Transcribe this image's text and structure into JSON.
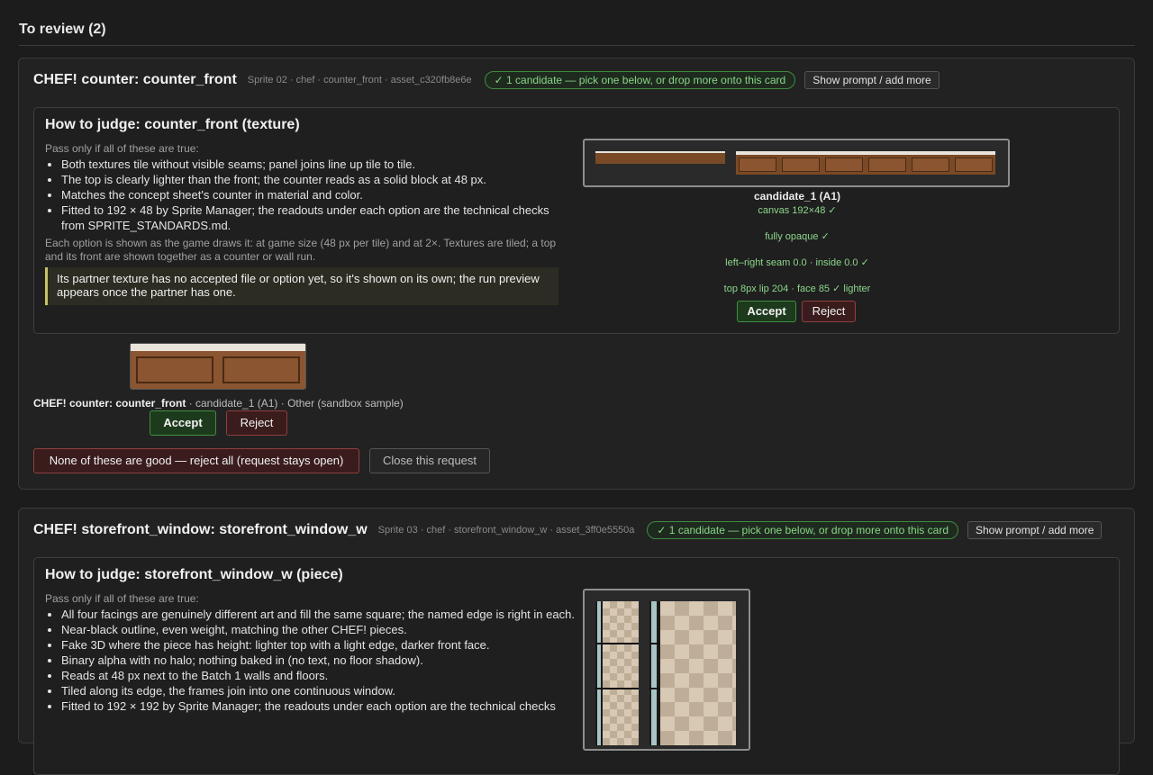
{
  "section": {
    "title": "To review (2)"
  },
  "cards": [
    {
      "title": "CHEF! counter: counter_front",
      "meta": "Sprite 02 · chef · counter_front · asset_c320fb8e6e",
      "candidate_pill": "✓ 1 candidate — pick one below, or drop more onto this card",
      "show_prompt": "Show prompt / add more",
      "judge": {
        "title": "How to judge: counter_front (texture)",
        "intro": "Pass only if all of these are true:",
        "criteria": [
          "Both textures tile without visible seams; panel joins line up tile to tile.",
          "The top is clearly lighter than the front; the counter reads as a solid block at 48 px.",
          "Matches the concept sheet's counter in material and color.",
          "Fitted to 192 × 48 by Sprite Manager; the readouts under each option are the technical checks from SPRITE_STANDARDS.md."
        ],
        "note": "Each option is shown as the game draws it: at game size (48 px per tile) and at 2×. Textures are tiled; a top and its front are shown together as a counter or wall run.",
        "warning": "Its partner texture has no accepted file or option yet, so it's shown on its own; the run preview appears once the partner has one."
      },
      "candidate": {
        "title": "candidate_1 (A1)",
        "checks": [
          "canvas 192×48 ✓",
          "fully opaque ✓",
          "left–right seam 0.0 · inside 0.0 ✓",
          "top 8px lip 204 · face 85 ✓ lighter"
        ],
        "accept": "Accept",
        "reject": "Reject"
      },
      "sample": {
        "name": "CHEF! counter: counter_front",
        "detail": " · candidate_1 (A1) · Other (sandbox sample)",
        "accept": "Accept",
        "reject": "Reject"
      },
      "reject_all": "None of these are good — reject all (request stays open)",
      "close": "Close this request"
    },
    {
      "title": "CHEF! storefront_window: storefront_window_w",
      "meta": "Sprite 03 · chef · storefront_window_w · asset_3ff0e5550a",
      "candidate_pill": "✓ 1 candidate — pick one below, or drop more onto this card",
      "show_prompt": "Show prompt / add more",
      "judge": {
        "title": "How to judge: storefront_window_w (piece)",
        "intro": "Pass only if all of these are true:",
        "criteria": [
          "All four facings are genuinely different art and fill the same square; the named edge is right in each.",
          "Near-black outline, even weight, matching the other CHEF! pieces.",
          "Fake 3D where the piece has height: lighter top with a light edge, darker front face.",
          "Binary alpha with no halo; nothing baked in (no text, no floor shadow).",
          "Reads at 48 px next to the Batch 1 walls and floors.",
          "Tiled along its edge, the frames join into one continuous window.",
          "Fitted to 192 × 192 by Sprite Manager; the readouts under each option are the technical checks"
        ]
      }
    }
  ],
  "colors": {
    "accent_green": "#86d586",
    "reject_red": "#8f3f3f",
    "warning_bar": "#c9c45a",
    "wood": "#8a5530"
  }
}
